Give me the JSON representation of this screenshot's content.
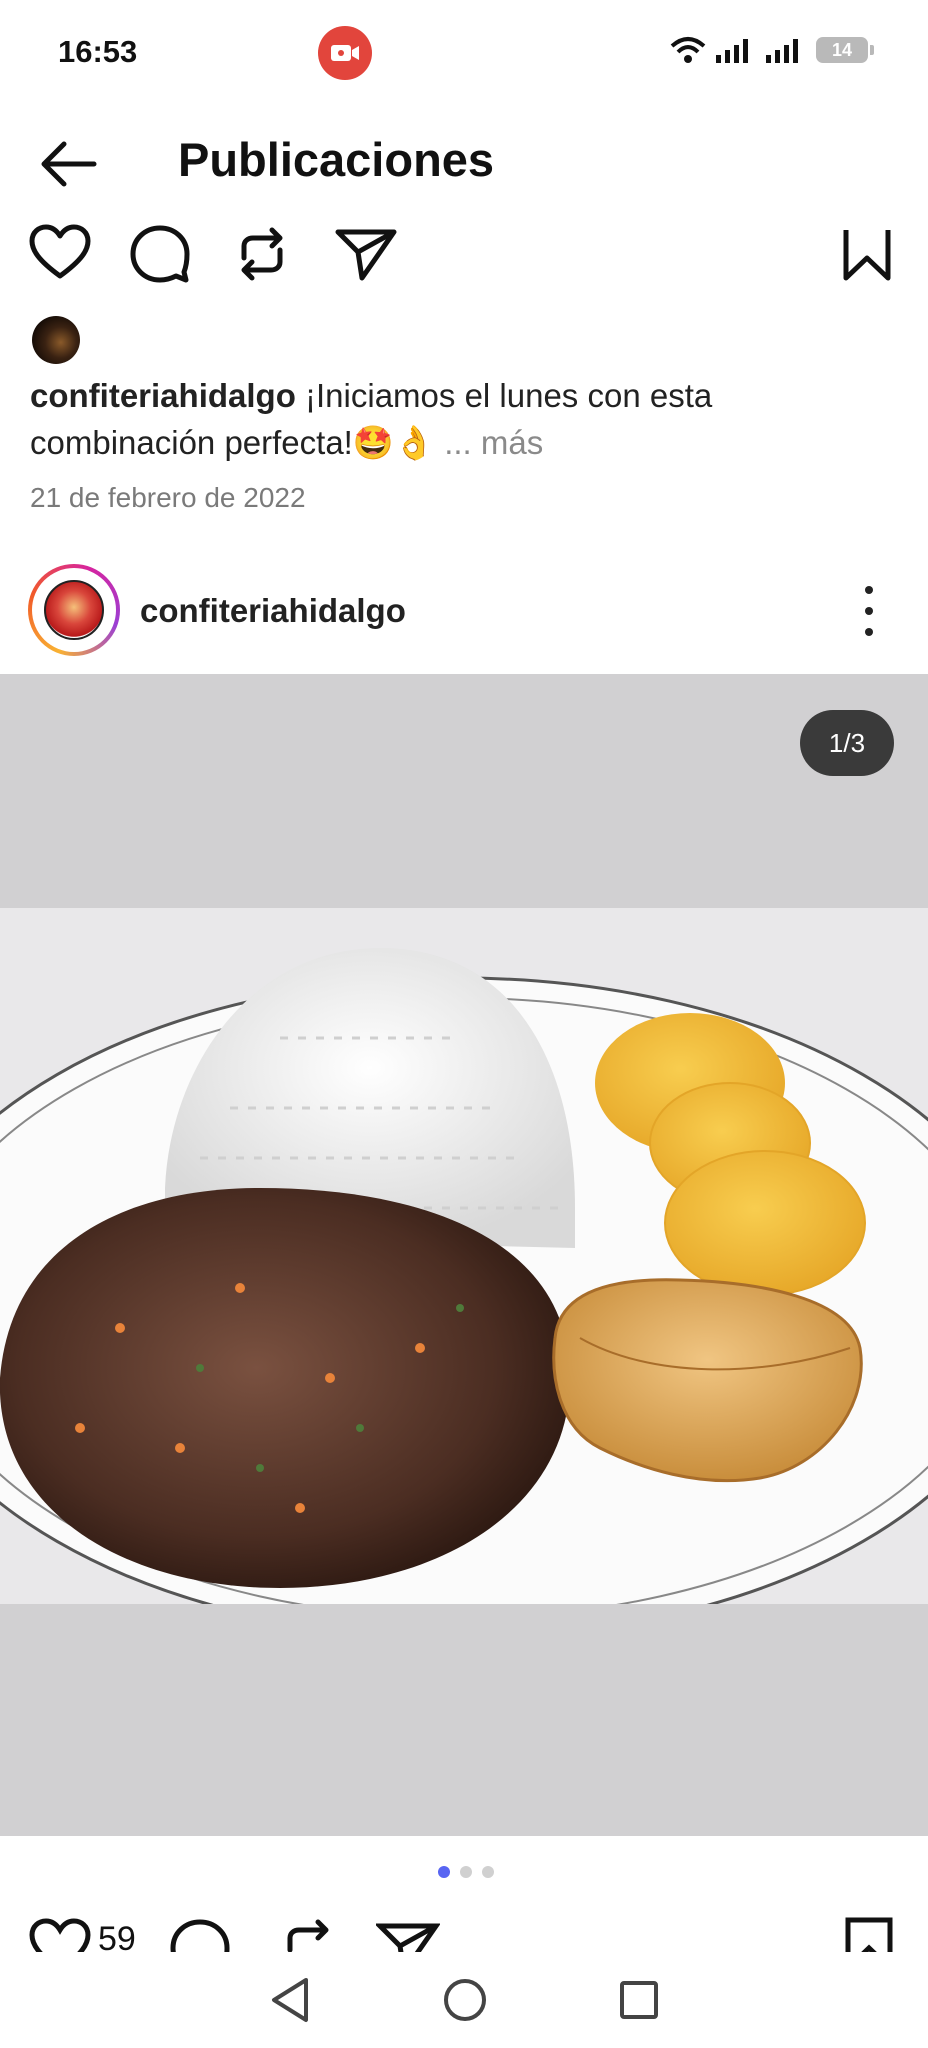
{
  "status_bar": {
    "time": "16:53",
    "battery_level": "14",
    "icons": [
      "screen-record-icon",
      "wifi-icon",
      "signal-icon",
      "signal-icon",
      "battery-icon"
    ]
  },
  "header": {
    "title": "Publicaciones"
  },
  "previous_post": {
    "caption_user": "confiteriahidalgo",
    "caption_text": " ¡Iniciamos el lunes con esta combinación perfecta!🤩👌",
    "more_label": "... más",
    "date": "21 de febrero de 2022"
  },
  "post": {
    "username": "confiteriahidalgo",
    "media_counter": "1/3",
    "carousel_index": 1,
    "carousel_total": 3,
    "likes": "59"
  },
  "colors": {
    "record": "#e2453c",
    "carousel_active": "#5865f2",
    "media_bg": "#d1d0d2"
  }
}
